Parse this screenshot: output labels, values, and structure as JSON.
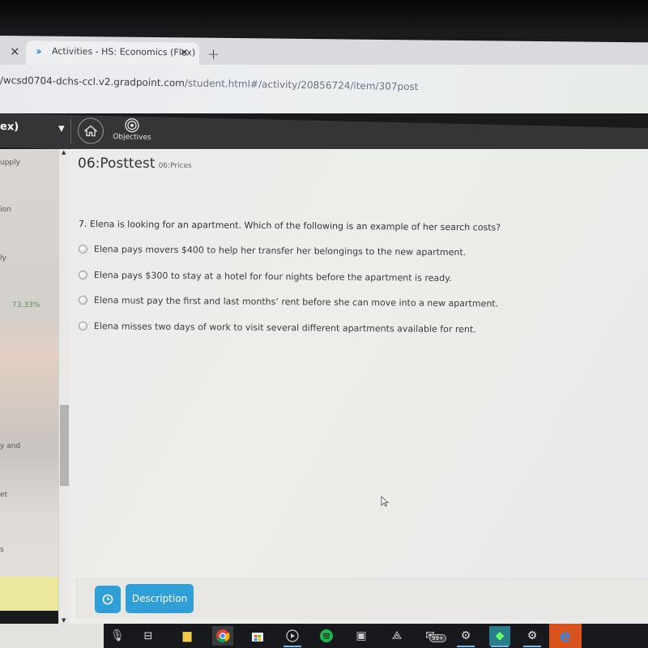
{
  "browser": {
    "tabs": [
      {
        "title": "",
        "close": "×"
      },
      {
        "title": "Activities - HS: Economics (Flex)",
        "close": "×",
        "active": true
      }
    ],
    "new_tab": "+",
    "url_host": "/wcsd0704-dchs-ccl.v2.gradpoint.com",
    "url_path": "/student.html#/activity/20856724/item/307post"
  },
  "appbar": {
    "course_label": "ex)",
    "objectives_label": "Objectives"
  },
  "sidebar": {
    "items": [
      "upply",
      "ion",
      "ly",
      "y and",
      "et",
      "s"
    ],
    "score": "73.33%"
  },
  "main": {
    "title": "06:Posttest",
    "subtitle": "06:Prices",
    "question": "7. Elena is looking for an apartment. Which of the following is an example of her search costs?",
    "options": [
      "Elena pays movers $400 to help her transfer her belongings to the new apartment.",
      "Elena pays $300 to stay at a hotel for four nights before the apartment is ready.",
      "Elena must pay the first and last months’ rent before she can move into a new apartment.",
      "Elena misses two days of work to visit several different apartments available for rent."
    ],
    "description_label": "Description"
  },
  "taskbar": {
    "icons": [
      "microphone-icon",
      "task-view-icon",
      "file-explorer-icon",
      "chrome-icon",
      "store-icon",
      "media-player-icon",
      "spotify-icon",
      "film-icon",
      "corsair-icon",
      "mail-icon",
      "steam-icon",
      "sims-icon",
      "settings-icon",
      "edge-icon"
    ],
    "mail_badge": "99+"
  },
  "colors": {
    "accent": "#2f9fd8",
    "appbar": "#353436",
    "score": "#5d8a5d"
  }
}
